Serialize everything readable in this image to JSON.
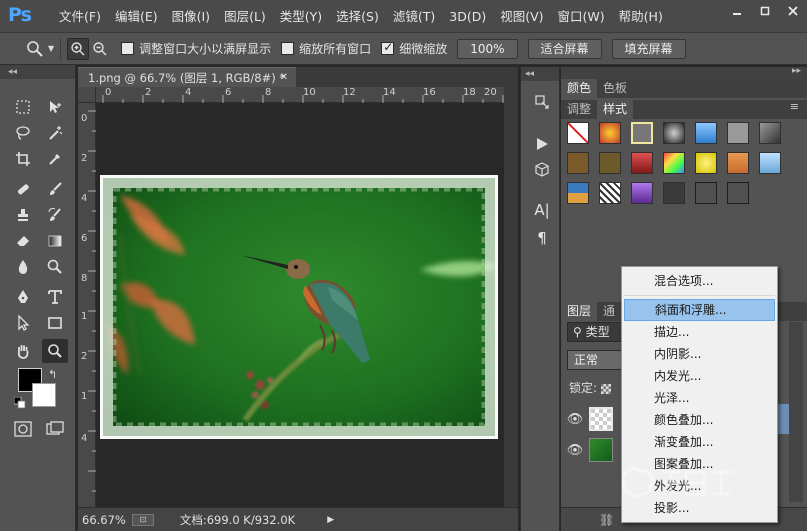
{
  "app": {
    "logo": "Ps",
    "menu": [
      "文件(F)",
      "编辑(E)",
      "图像(I)",
      "图层(L)",
      "类型(Y)",
      "选择(S)",
      "滤镜(T)",
      "3D(D)",
      "视图(V)",
      "窗口(W)",
      "帮助(H)"
    ],
    "window_controls": [
      "minimize-icon",
      "restore-icon",
      "close-icon"
    ]
  },
  "options_bar": {
    "resize_windows_label": "调整窗口大小以满屏显示",
    "resize_windows_checked": false,
    "zoom_all_label": "缩放所有窗口",
    "zoom_all_checked": false,
    "scrubby_zoom_label": "细微缩放",
    "scrubby_zoom_checked": true,
    "actual_pixels_label": "100%",
    "fit_screen_label": "适合屏幕",
    "fill_screen_label": "填充屏幕"
  },
  "document": {
    "tab_title": "1.png @ 66.7% (图层 1, RGB/8#) *",
    "ruler_ticks": [
      "0",
      "2",
      "4",
      "6",
      "8",
      "10",
      "12",
      "14",
      "16",
      "18",
      "20"
    ],
    "ruler_left_ticks": [
      "0",
      "2",
      "4",
      "6",
      "8",
      "1",
      "2",
      "1",
      "4"
    ],
    "zoom": "66.67%",
    "doc_size": "文档:699.0 K/932.0K"
  },
  "panels": {
    "color_tabs": [
      "颜色",
      "色板"
    ],
    "style_tabs": [
      "调整",
      "样式"
    ],
    "layers_tabs": [
      "图层",
      "通"
    ],
    "layer_filter": "类型",
    "blend_mode": "正常",
    "lock_label": "锁定:",
    "style_swatch_colors": [
      "#ffffff",
      "#c0392b",
      "#777777",
      "#444444",
      "#2f7fd0",
      "#9a9a9a",
      "#606060",
      "#7a5a2a",
      "#6d5a2a",
      "#b03030",
      "#5a7a9a",
      "#d4c400",
      "#c86a30",
      "#6aa8d8",
      "#3a7ac0",
      "#cccccc",
      "#7a4ab0",
      "#3a3a3a",
      "#505050",
      "#505050"
    ]
  },
  "context_menu": {
    "items": [
      "混合选项...",
      "斜面和浮雕...",
      "描边...",
      "内阴影...",
      "内发光...",
      "光泽...",
      "颜色叠加...",
      "渐变叠加...",
      "图案叠加...",
      "外发光...",
      "投影..."
    ],
    "highlighted": "斜面和浮雕..."
  },
  "colors": {
    "app_bg": "#535353",
    "menu_highlight": "#97c3ec",
    "foreground": "#000000",
    "background": "#ffffff"
  }
}
